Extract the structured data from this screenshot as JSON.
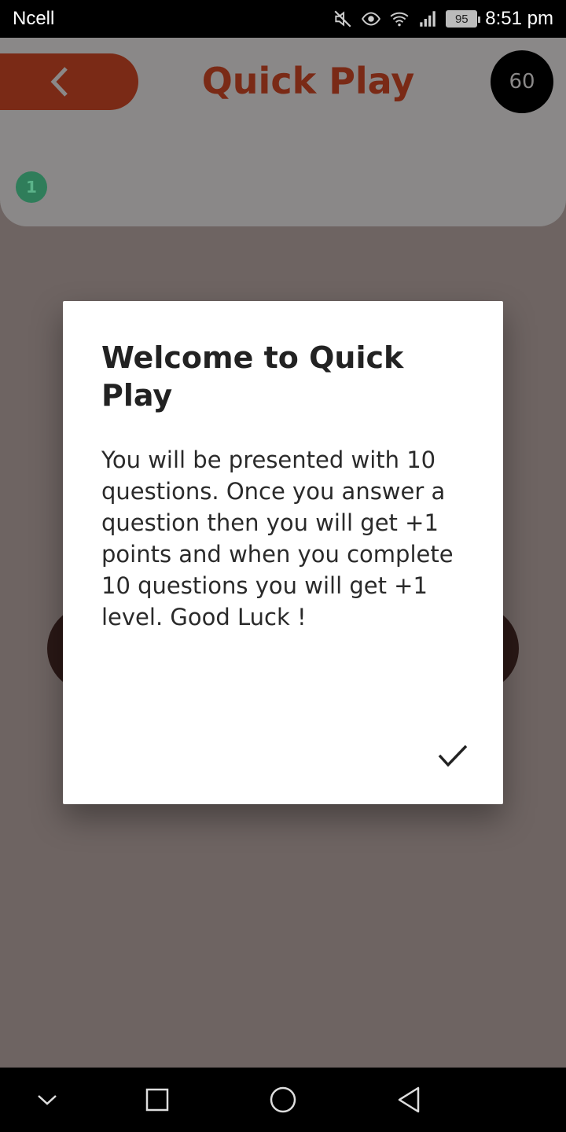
{
  "status_bar": {
    "carrier": "Ncell",
    "battery": "95",
    "time": "8:51 pm",
    "icons": [
      "mute-icon",
      "eye-icon",
      "wifi-icon",
      "signal-icon",
      "battery-icon"
    ]
  },
  "header": {
    "title": "Quick Play",
    "score": "60",
    "level": "1",
    "accent_color": "#7a2a16"
  },
  "dialog": {
    "title": "Welcome to Quick Play",
    "body": "You will be presented with 10 questions. Once you answer a question then you will get +1 points and when you complete 10 questions you will get +1 level. Good Luck !",
    "confirm_icon": "checkmark-icon"
  },
  "nav_bar": {
    "icons": [
      "chevron-down-icon",
      "recent-apps-icon",
      "home-icon",
      "back-icon"
    ]
  }
}
